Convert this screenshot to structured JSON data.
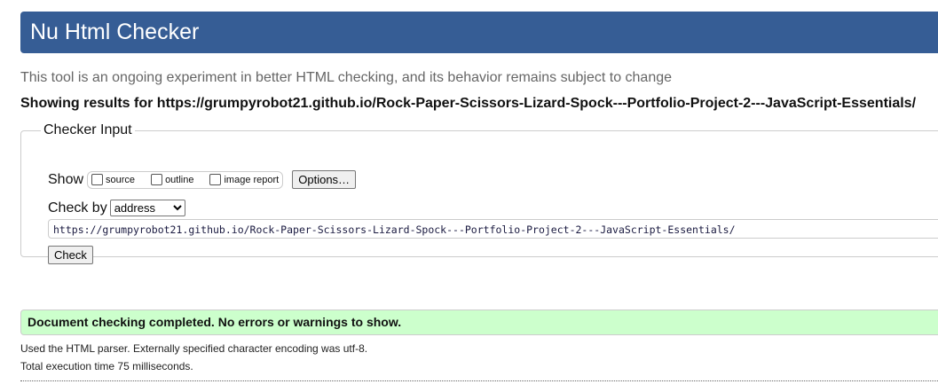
{
  "header": {
    "title": "Nu Html Checker"
  },
  "intro": "This tool is an ongoing experiment in better HTML checking, and its behavior remains subject to change",
  "showing": "Showing results for https://grumpyrobot21.github.io/Rock-Paper-Scissors-Lizard-Spock---Portfolio-Project-2---JavaScript-Essentials/",
  "checker": {
    "legend": "Checker Input",
    "show_label": "Show",
    "options": [
      {
        "label": "source",
        "checked": false
      },
      {
        "label": "outline",
        "checked": false
      },
      {
        "label": "image report",
        "checked": false
      }
    ],
    "options_button": "Options…",
    "check_by_label": "Check by",
    "check_by_value": "address",
    "url": "https://grumpyrobot21.github.io/Rock-Paper-Scissors-Lizard-Spock---Portfolio-Project-2---JavaScript-Essentials/",
    "check_button": "Check"
  },
  "result": {
    "success": "Document checking completed. No errors or warnings to show.",
    "parser": "Used the HTML parser. Externally specified character encoding was utf-8.",
    "time": "Total execution time 75 milliseconds."
  }
}
